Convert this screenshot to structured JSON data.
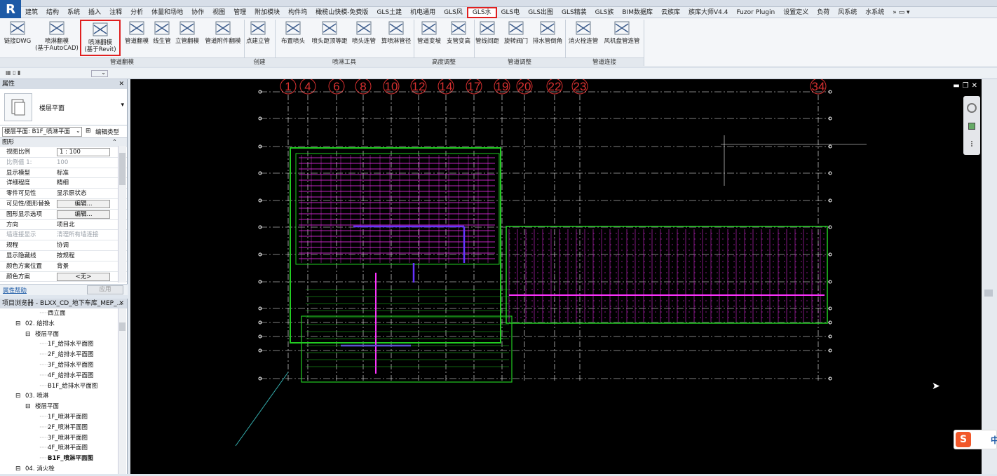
{
  "menu": [
    "建筑",
    "结构",
    "系统",
    "插入",
    "注释",
    "分析",
    "体量和场地",
    "协作",
    "视图",
    "管理",
    "附加模块",
    "构件坞",
    "橄榄山快模-免费版",
    "GLS土建",
    "机电通用",
    "GLS风",
    "GLS水",
    "GLS电",
    "GLS出图",
    "GLS精装",
    "GLS族",
    "BIM数据库",
    "云族库",
    "族库大师V4.4",
    "Fuzor Plugin",
    "设置定义",
    "负荷",
    "风系统",
    "水系统"
  ],
  "ribbon": {
    "buttons": [
      {
        "name": "link-dwg",
        "label": "链接DWG",
        "label2": ""
      },
      {
        "name": "spray-flip-cad",
        "label": "喷淋翻模",
        "label2": "(基于AutoCAD)"
      },
      {
        "name": "spray-flip-revit",
        "label": "喷淋翻模",
        "label2": "(基于Revit)"
      },
      {
        "name": "pipe-flip",
        "label": "管道翻模",
        "label2": ""
      },
      {
        "name": "line-pipe",
        "label": "线生管",
        "label2": ""
      },
      {
        "name": "riser-flip",
        "label": "立管翻模",
        "label2": ""
      },
      {
        "name": "pipe-fitting-flip",
        "label": "管道附件翻模",
        "label2": ""
      },
      {
        "name": "point-riser",
        "label": "点建立管",
        "label2": ""
      },
      {
        "name": "place-head",
        "label": "布置喷头",
        "label2": ""
      },
      {
        "name": "head-spacing",
        "label": "喷头距顶等距",
        "label2": ""
      },
      {
        "name": "head-connect",
        "label": "喷头连管",
        "label2": ""
      },
      {
        "name": "calc-pipe-dia",
        "label": "算喷淋管径",
        "label2": ""
      },
      {
        "name": "pipe-change",
        "label": "管道变坡",
        "label2": ""
      },
      {
        "name": "support-change",
        "label": "支管变高",
        "label2": ""
      },
      {
        "name": "pipe-spacing",
        "label": "管线间距",
        "label2": ""
      },
      {
        "name": "rotate-valve",
        "label": "旋转阀门",
        "label2": ""
      },
      {
        "name": "drain-chamfer",
        "label": "排水管倒角",
        "label2": ""
      },
      {
        "name": "hydrant-connect",
        "label": "消火栓连管",
        "label2": ""
      },
      {
        "name": "fan-coil-connect",
        "label": "风机盘管连管",
        "label2": ""
      }
    ],
    "panels": [
      "管道翻模",
      "创建",
      "喷淋工具",
      "高度调整",
      "管道调整",
      "管道连接"
    ]
  },
  "properties": {
    "title": "属性",
    "type_name": "楼层平面",
    "view_selector": "楼层平面: B1F_喷淋平面",
    "edit_type": "编辑类型",
    "section": "图形",
    "rows": [
      {
        "k": "视图比例",
        "v": "1 : 100",
        "style": "input"
      },
      {
        "k": "比例值 1:",
        "v": "100",
        "style": "dim"
      },
      {
        "k": "显示模型",
        "v": "标准",
        "style": ""
      },
      {
        "k": "详细程度",
        "v": "精细",
        "style": ""
      },
      {
        "k": "零件可见性",
        "v": "显示原状态",
        "style": ""
      },
      {
        "k": "可见性/图形替换",
        "v": "编辑...",
        "style": "btn"
      },
      {
        "k": "图形显示选项",
        "v": "编辑...",
        "style": "btn"
      },
      {
        "k": "方向",
        "v": "项目北",
        "style": ""
      },
      {
        "k": "墙连接显示",
        "v": "清理所有墙连接",
        "style": "dim"
      },
      {
        "k": "规程",
        "v": "协调",
        "style": ""
      },
      {
        "k": "显示隐藏线",
        "v": "按规程",
        "style": ""
      },
      {
        "k": "颜色方案位置",
        "v": "背景",
        "style": ""
      },
      {
        "k": "颜色方案",
        "v": "<无>",
        "style": "btn"
      }
    ],
    "help": "属性帮助",
    "apply": "应用"
  },
  "browser": {
    "title": "项目浏览器 - BLXX_CD_地下车库_MEP_...",
    "nodes": [
      {
        "t": "西立面",
        "lvl": 3,
        "exp": ""
      },
      {
        "t": "02. 给排水",
        "lvl": 1,
        "exp": "−"
      },
      {
        "t": "楼层平面",
        "lvl": 2,
        "exp": "−"
      },
      {
        "t": "1F_给排水平面图",
        "lvl": 3,
        "exp": ""
      },
      {
        "t": "2F_给排水平面图",
        "lvl": 3,
        "exp": ""
      },
      {
        "t": "3F_给排水平面图",
        "lvl": 3,
        "exp": ""
      },
      {
        "t": "4F_给排水平面图",
        "lvl": 3,
        "exp": ""
      },
      {
        "t": "B1F_给排水平面图",
        "lvl": 3,
        "exp": ""
      },
      {
        "t": "03. 喷淋",
        "lvl": 1,
        "exp": "−"
      },
      {
        "t": "楼层平面",
        "lvl": 2,
        "exp": "−"
      },
      {
        "t": "1F_喷淋平面图",
        "lvl": 3,
        "exp": ""
      },
      {
        "t": "2F_喷淋平面图",
        "lvl": 3,
        "exp": ""
      },
      {
        "t": "3F_喷淋平面图",
        "lvl": 3,
        "exp": ""
      },
      {
        "t": "4F_喷淋平面图",
        "lvl": 3,
        "exp": ""
      },
      {
        "t": "B1F_喷淋平面图",
        "lvl": 3,
        "exp": "",
        "bold": true
      },
      {
        "t": "04. 消火栓",
        "lvl": 1,
        "exp": "−"
      }
    ]
  },
  "grid_labels": [
    "1",
    "4",
    "6",
    "8",
    "10",
    "12",
    "14",
    "17",
    "19",
    "20",
    "22",
    "23",
    "34"
  ],
  "colors": {
    "bg": "#000000",
    "grid": "#ffffff",
    "bubble": "#d83030",
    "wall": "#22cc22",
    "sprinkler": "#ff33ff",
    "main_pipe": "#6633ff",
    "highlight": "#e02020"
  },
  "ime": "中"
}
